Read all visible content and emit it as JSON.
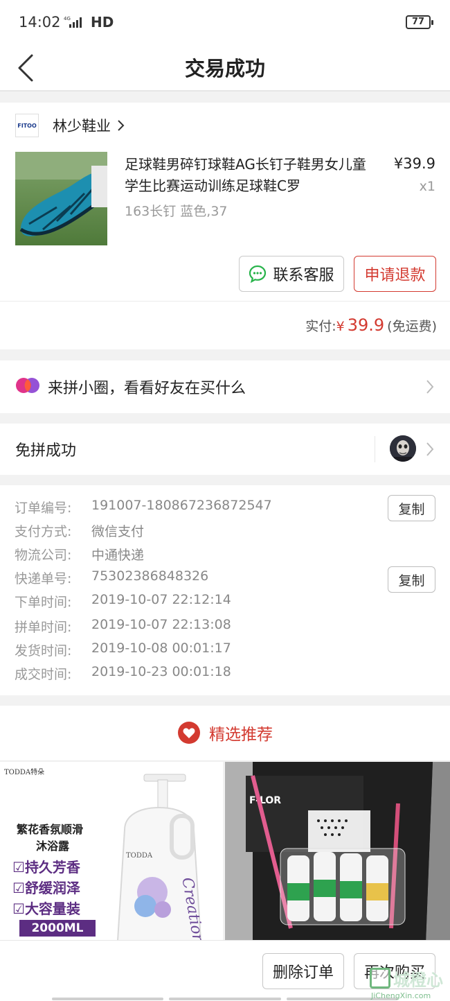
{
  "status": {
    "time": "14:02",
    "network": "4G",
    "hd": "HD",
    "battery": "77"
  },
  "nav": {
    "title": "交易成功"
  },
  "shop": {
    "logo_text": "FITOO",
    "name": "林少鞋业"
  },
  "product": {
    "title": "足球鞋男碎钉球鞋AG长钉子鞋男女儿童学生比赛运动训练足球鞋C罗",
    "spec": "163长钉 蓝色,37",
    "price": "¥39.9",
    "qty": "x1"
  },
  "actions": {
    "service": "联系客服",
    "refund": "申请退款"
  },
  "payment": {
    "label": "实付:",
    "currency": "¥",
    "amount": "39.9",
    "note": "(免运费)"
  },
  "circle": {
    "text": "来拼小圈，看看好友在买什么"
  },
  "group": {
    "text": "免拼成功"
  },
  "info": [
    {
      "k": "订单编号:",
      "v": "191007-180867236872547"
    },
    {
      "k": "支付方式:",
      "v": "微信支付"
    },
    {
      "k": "物流公司:",
      "v": "中通快递"
    },
    {
      "k": "快递单号:",
      "v": "75302386848326"
    },
    {
      "k": "下单时间:",
      "v": "2019-10-07 22:12:14"
    },
    {
      "k": "拼单时间:",
      "v": "2019-10-07 22:13:08"
    },
    {
      "k": "发货时间:",
      "v": "2019-10-08 00:01:17"
    },
    {
      "k": "成交时间:",
      "v": "2019-10-23 00:01:18"
    }
  ],
  "copy_label": "复制",
  "recommend": {
    "title": "精选推荐",
    "left": {
      "brand": "TODDA",
      "brand_cn": "特朵",
      "headline": "繁花香氛顺滑",
      "subline": "沐浴露",
      "features": [
        "持久芳香",
        "舒缓润泽",
        "大容量装"
      ],
      "volume": "2000ML"
    }
  },
  "bottom": {
    "delete": "删除订单",
    "again": "再次购买"
  },
  "watermark": {
    "big": "城橙心",
    "small": "JiChengXin.com"
  },
  "colors": {
    "accent": "#d33a30",
    "wechat_green": "#27b34a"
  }
}
